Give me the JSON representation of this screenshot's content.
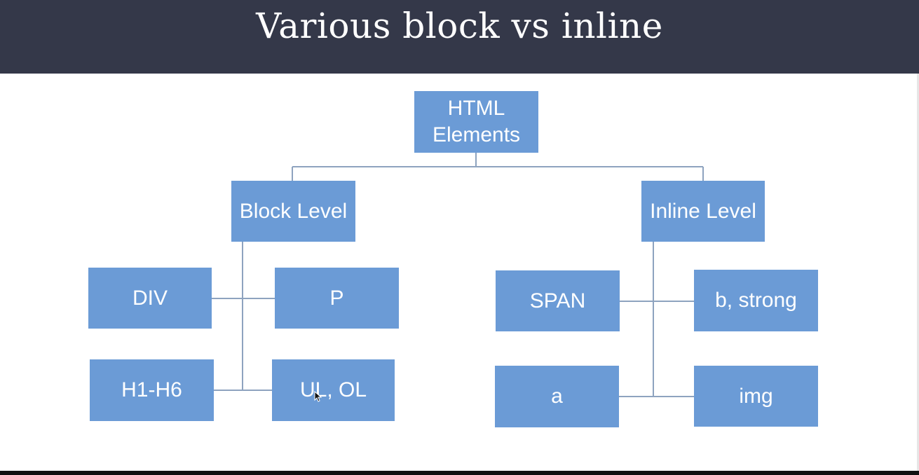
{
  "slide": {
    "title": "Various block vs inline"
  },
  "diagram": {
    "root": "HTML\nElements",
    "block_level": "Block Level",
    "inline_level": "Inline Level",
    "block_children": [
      "DIV",
      "P",
      "H1-H6",
      "UL, OL"
    ],
    "inline_children": [
      "SPAN",
      "b, strong",
      "a",
      "img"
    ]
  },
  "colors": {
    "header_bg": "#343849",
    "node_fill": "#6b9bd6",
    "connector": "#8ea3bf"
  }
}
